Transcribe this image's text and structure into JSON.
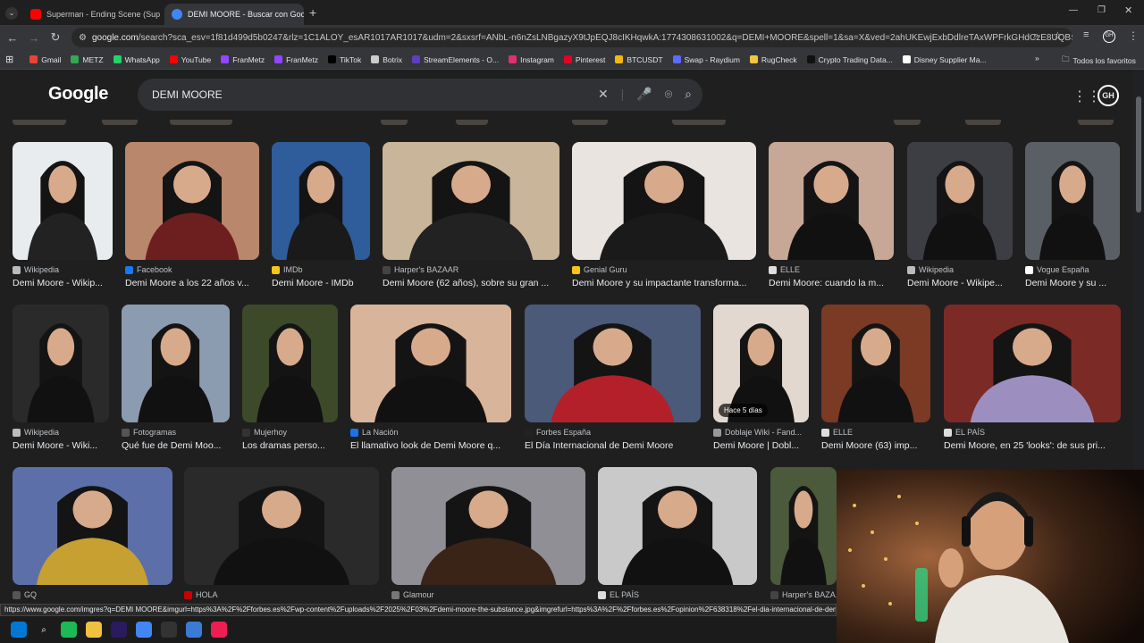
{
  "tabs": [
    {
      "title": "Superman - Ending Scene (Sup",
      "favicon_color": "#ff0000"
    },
    {
      "title": "DEMI MOORE - Buscar con Goo",
      "favicon_color": "#4285f4"
    }
  ],
  "omnibox": {
    "host": "google.com",
    "path": "/search?sca_esv=1f81d499d5b0247&rlz=1C1ALOY_esAR1017AR1017&udm=2&sxsrf=ANbL-n6nZsLNBgazyX9tJpEQJ8cIKHqwkA:1774308631002&q=DEMI+MOORE&spell=1&sa=X&ved=2ahUKEwjExbDdlreTAxWPFrkGHdCzE8UQBSgAegQIC..."
  },
  "bookmarks": [
    {
      "label": "Gmail",
      "color": "#ea4335"
    },
    {
      "label": "METZ",
      "color": "#34a853"
    },
    {
      "label": "WhatsApp",
      "color": "#25d366"
    },
    {
      "label": "YouTube",
      "color": "#ff0000"
    },
    {
      "label": "FranMetz",
      "color": "#9146ff"
    },
    {
      "label": "FranMetz",
      "color": "#9146ff"
    },
    {
      "label": "TikTok",
      "color": "#000000"
    },
    {
      "label": "Botrix",
      "color": "#cccccc"
    },
    {
      "label": "StreamElements - O...",
      "color": "#5c3ec2"
    },
    {
      "label": "Instagram",
      "color": "#e1306c"
    },
    {
      "label": "Pinterest",
      "color": "#e60023"
    },
    {
      "label": "BTCUSDT",
      "color": "#f0b90b"
    },
    {
      "label": "Swap - Raydium",
      "color": "#5b6bff"
    },
    {
      "label": "RugCheck",
      "color": "#f5c542"
    },
    {
      "label": "Crypto Trading Data...",
      "color": "#111111"
    },
    {
      "label": "Disney Supplier Ma...",
      "color": "#ffffff"
    }
  ],
  "bookmarks_overflow": "»",
  "bookmarks_all": "Todos los favoritos",
  "google": {
    "logo": "Google",
    "query": "DEMI MOORE",
    "account_initials": "GH"
  },
  "rows": [
    [
      {
        "source": "Wikipedia",
        "title": "Demi Moore - Wikip...",
        "icon": "#bbbbbb",
        "tone": [
          "#e9ecef",
          "#222"
        ]
      },
      {
        "source": "Facebook",
        "title": "Demi Moore a los 22 años v...",
        "icon": "#1877f2",
        "tone": [
          "#b9876b",
          "#6d1f1f"
        ]
      },
      {
        "source": "IMDb",
        "title": "Demi Moore - IMDb",
        "icon": "#f5c518",
        "tone": [
          "#2f5d9b",
          "#1a1a1a"
        ]
      },
      {
        "source": "Harper's BAZAAR",
        "title": "Demi Moore (62 años), sobre su gran ...",
        "icon": "#444444",
        "tone": [
          "#c9b59a",
          "#222"
        ]
      },
      {
        "source": "Genial Guru",
        "title": "Demi Moore y su impactante transforma...",
        "icon": "#f5c518",
        "tone": [
          "#e9e4df",
          "#1a1a1a"
        ]
      },
      {
        "source": "ELLE",
        "title": "Demi Moore: cuando la m...",
        "icon": "#dddddd",
        "tone": [
          "#c7a796",
          "#111"
        ]
      },
      {
        "source": "Wikipedia",
        "title": "Demi Moore - Wikipe...",
        "icon": "#bbbbbb",
        "tone": [
          "#3d3d44",
          "#111"
        ]
      },
      {
        "source": "Vogue España",
        "title": "Demi Moore y su ...",
        "icon": "#ffffff",
        "tone": [
          "#5a5f66",
          "#111"
        ]
      }
    ],
    [
      {
        "source": "Wikipedia",
        "title": "Demi Moore - Wiki...",
        "icon": "#bbbbbb",
        "tone": [
          "#2a2a2a",
          "#111"
        ]
      },
      {
        "source": "Fotogramas",
        "title": "Qué fue de Demi Moo...",
        "icon": "#555555",
        "tone": [
          "#8b9bb0",
          "#111"
        ]
      },
      {
        "source": "Mujerhoy",
        "title": "Los dramas perso...",
        "icon": "#333333",
        "tone": [
          "#3c4a2a",
          "#111"
        ]
      },
      {
        "source": "La Nación",
        "title": "El llamativo look de Demi Moore q...",
        "icon": "#1a73e8",
        "tone": [
          "#d8b49a",
          "#111"
        ]
      },
      {
        "source": "Forbes España",
        "title": "El Día Internacional de Demi Moore",
        "icon": "#222222",
        "tone": [
          "#4b5a78",
          "#b3202a"
        ]
      },
      {
        "source": "Doblaje Wiki - Fand...",
        "title": "Demi Moore | Dobl...",
        "icon": "#999999",
        "tone": [
          "#e3d8cf",
          "#111"
        ],
        "badge": "Hace 5 días"
      },
      {
        "source": "ELLE",
        "title": "Demi Moore (63) imp...",
        "icon": "#dddddd",
        "tone": [
          "#7a3a24",
          "#111"
        ]
      },
      {
        "source": "EL PAÍS",
        "title": "Demi Moore, en 25 'looks': de sus pri...",
        "icon": "#dddddd",
        "tone": [
          "#7b2a26",
          "#9c8fc0"
        ]
      }
    ],
    [
      {
        "source": "GQ",
        "title": "",
        "icon": "#555555",
        "tone": [
          "#5c6fa8",
          "#c6a030"
        ]
      },
      {
        "source": "HOLA",
        "title": "",
        "icon": "#cc0000",
        "tone": [
          "#2a2a2a",
          "#111"
        ]
      },
      {
        "source": "Glamour",
        "title": "",
        "icon": "#777777",
        "tone": [
          "#8f8f95",
          "#3a2418"
        ]
      },
      {
        "source": "EL PAÍS",
        "title": "",
        "icon": "#dddddd",
        "tone": [
          "#c9c9c9",
          "#111"
        ]
      },
      {
        "source": "Harper's BAZA...",
        "title": "",
        "icon": "#444444",
        "tone": [
          "#4a5a3a",
          "#111"
        ]
      }
    ]
  ],
  "status_url": "https://www.google.com/imgres?q=DEMI MOORE&imgurl=https%3A%2F%2Fforbes.es%2Fwp-content%2Fuploads%2F2025%2F03%2Fdemi-moore-the-substance.jpg&imgrefurl=https%3A%2F%2Fforbes.es%2Fopinion%2F638318%2Fel-dia-internacional-de-demi-m",
  "taskbar": [
    {
      "name": "windows-start-icon",
      "color": "#0078d4"
    },
    {
      "name": "search-taskbar-icon",
      "color": "transparent"
    },
    {
      "name": "spotify-icon",
      "color": "#1db954"
    },
    {
      "name": "file-explorer-icon",
      "color": "#f0c040"
    },
    {
      "name": "premiere-icon",
      "color": "#2a1a5e"
    },
    {
      "name": "chrome-icon",
      "color": "#4285f4"
    },
    {
      "name": "obs-icon",
      "color": "#333333"
    },
    {
      "name": "store-icon",
      "color": "#3a7bd5"
    },
    {
      "name": "tiktok-taskbar-icon",
      "color": "#ee1d52"
    }
  ]
}
